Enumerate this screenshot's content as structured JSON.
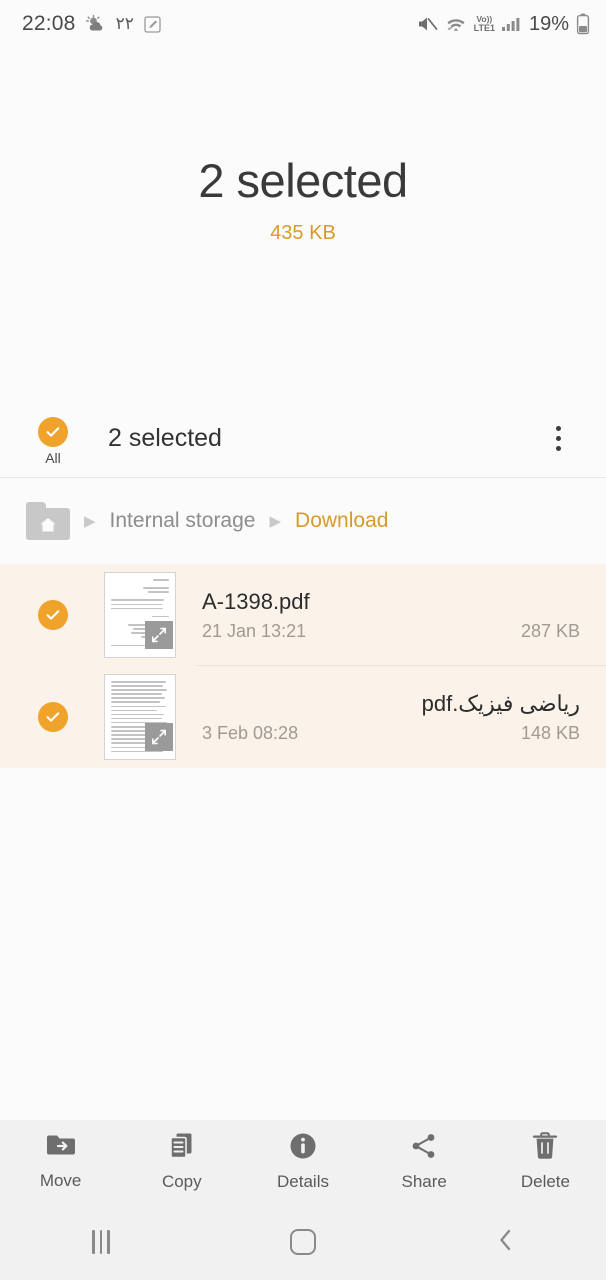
{
  "statusbar": {
    "time": "22:08",
    "weather_icon": "sun-behind-cloud-icon",
    "temperature": "٢٢",
    "screenshot_icon": "screenshot-edit-icon",
    "mute_icon": "mute-icon",
    "wifi_icon": "wifi-icon",
    "volte_label_top": "Vo))",
    "volte_label_bottom": "LTE1",
    "signal_icon": "signal-bars-icon",
    "battery_percent": "19%",
    "battery_icon": "battery-low-icon"
  },
  "header": {
    "title": "2 selected",
    "subtitle": "435 KB",
    "accent_color": "#d79a2b"
  },
  "actionbar": {
    "all_label": "All",
    "all_checked": true,
    "title": "2 selected",
    "overflow_icon": "more-vertical-icon"
  },
  "breadcrumb": {
    "home_icon": "home-folder-icon",
    "separator": "▶",
    "items": [
      {
        "label": "Internal storage",
        "active": false
      },
      {
        "label": "Download",
        "active": true
      }
    ]
  },
  "files": [
    {
      "name": "A-1398.pdf",
      "date": "21 Jan 13:21",
      "size": "287 KB",
      "selected": true,
      "thumbnail": "pdf-page-thumbnail",
      "rtl": false
    },
    {
      "name": "ریاضی فیزیک.pdf",
      "date": "3 Feb 08:28",
      "size": "148 KB",
      "selected": true,
      "thumbnail": "pdf-page-thumbnail",
      "rtl": true
    }
  ],
  "toolbar": {
    "items": [
      {
        "label": "Move",
        "icon": "folder-move-icon"
      },
      {
        "label": "Copy",
        "icon": "copy-documents-icon"
      },
      {
        "label": "Details",
        "icon": "info-circle-icon"
      },
      {
        "label": "Share",
        "icon": "share-nodes-icon"
      },
      {
        "label": "Delete",
        "icon": "trash-icon"
      }
    ]
  },
  "navbar": {
    "recents_icon": "recents-icon",
    "home_icon": "home-icon",
    "back_icon": "back-chevron-icon"
  },
  "colors": {
    "accent": "#f0a32a",
    "selected_row_bg": "#fbf3ea",
    "page_bg": "#fbfbfb",
    "toolbar_bg": "#f1f1f1"
  }
}
